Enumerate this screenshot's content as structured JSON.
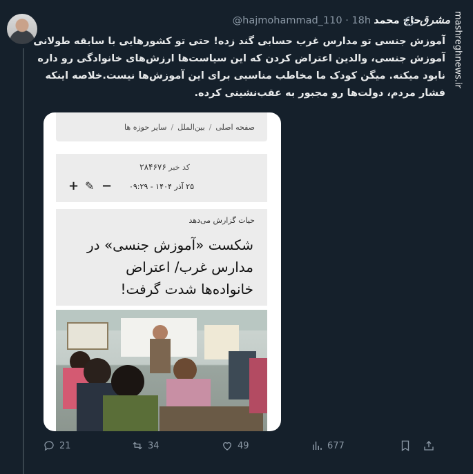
{
  "tweet": {
    "author_name": "حاج محمد",
    "handle": "@hajmohammad_110",
    "time": "· 18h",
    "text": "آموزش جنسی تو مدارس غرب حسابی گند زده! حتی تو کشورهایی با سابقه طولانی آموزش جنسی، والدین اعتراض کردن که این سیاست‌ها ارزش‌های خانوادگی رو داره نابود میکنه. میگن کودک ما مخاطب مناسبی برای این آموزش‌ها نیست.خلاصه اینکه فشار مردم، دولت‌ها رو مجبور به عقب‌نشینی کرده."
  },
  "branding": {
    "logo_text": "مشرق",
    "watermark": "mashreghnews.ir"
  },
  "card": {
    "breadcrumbs": [
      "صفحه اصلی",
      "بین‌الملل",
      "سایر حوزه ها"
    ],
    "breadcrumb_sep": "/",
    "code_label": "کد خبر",
    "code_value": "۲۸۴۶۷۶",
    "date": "۲۵ آذر ۱۴۰۴ - ۰۹:۲۹",
    "controls": {
      "plus": "+",
      "edit": "✎",
      "minus": "−"
    },
    "reporter": "حیات گزارش می‌دهد",
    "headline": "شکست «آموزش جنسی» در مدارس غرب/ اعتراض خانواده‌ها شدت گرفت!"
  },
  "actions": {
    "replies": "21",
    "reposts": "34",
    "likes": "49",
    "views": "677"
  },
  "icons": {
    "reply": "reply-icon",
    "repost": "repost-icon",
    "like": "heart-icon",
    "views": "views-icon",
    "bookmark": "bookmark-icon",
    "share": "share-icon"
  }
}
